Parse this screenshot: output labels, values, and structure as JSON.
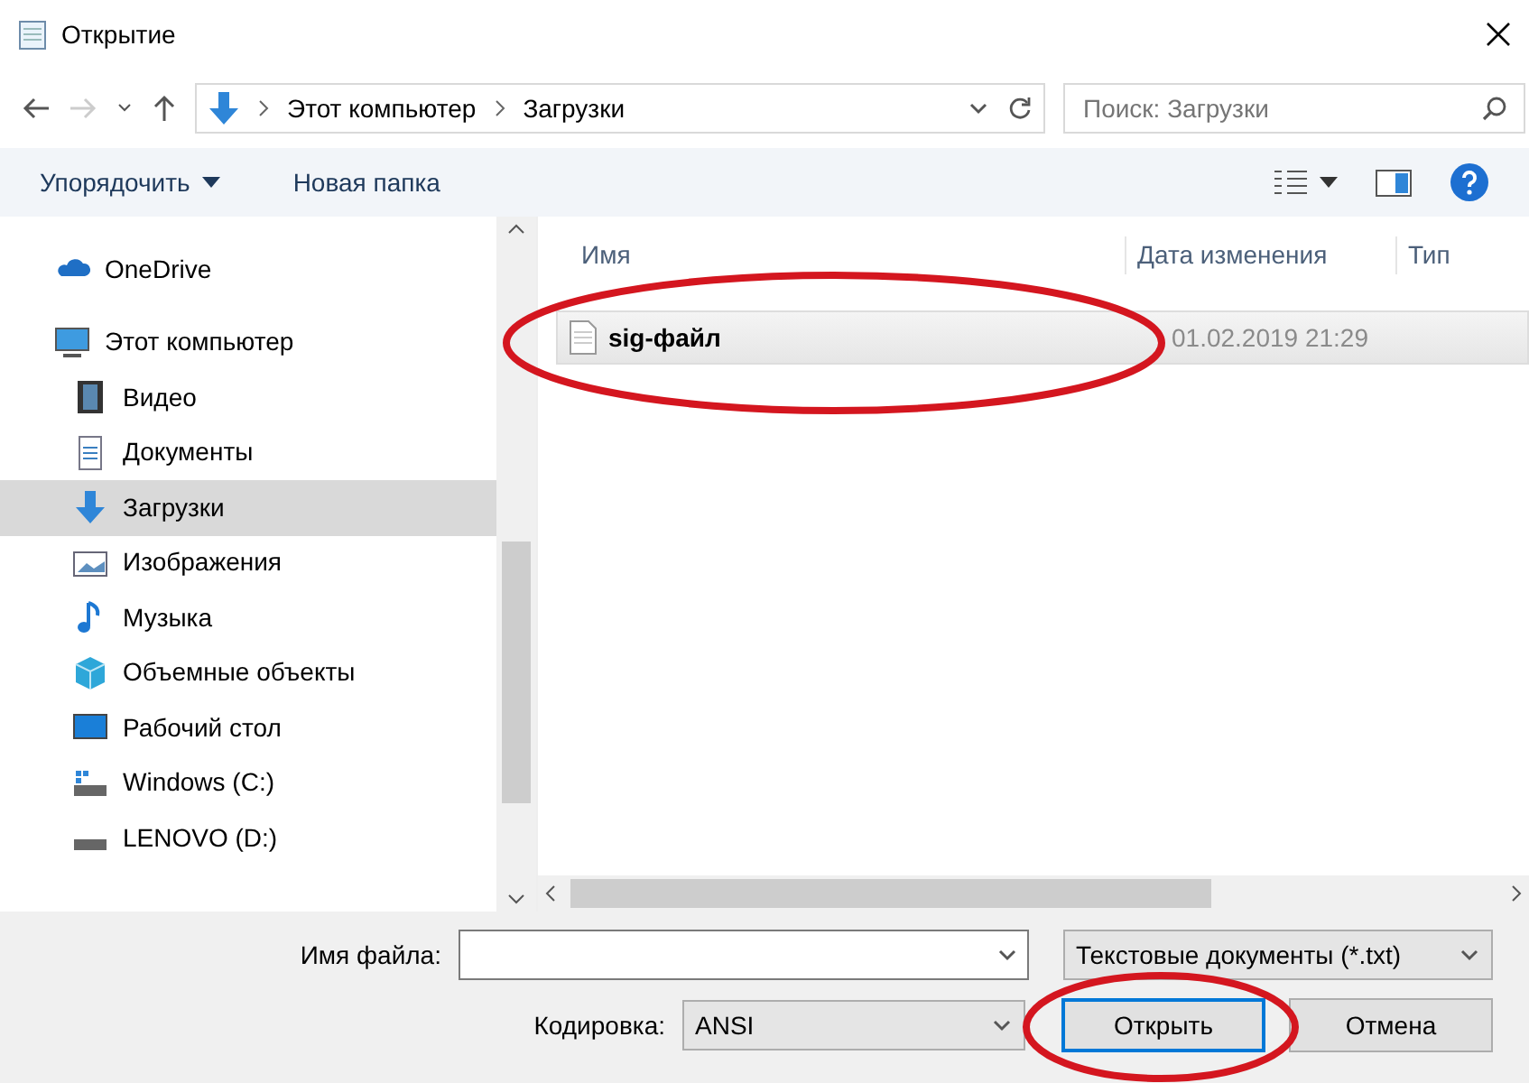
{
  "window": {
    "title": "Открытие"
  },
  "address_bar": {
    "segments": [
      "Этот компьютер",
      "Загрузки"
    ]
  },
  "search": {
    "placeholder": "Поиск: Загрузки"
  },
  "toolbar": {
    "buttons": [
      "Упорядочить",
      "Новая папка"
    ]
  },
  "sidebar": {
    "items": [
      {
        "label": "OneDrive",
        "kind": "cloud",
        "selected": false
      },
      {
        "label": "Этот компьютер",
        "kind": "computer",
        "selected": false,
        "children": [
          {
            "label": "Видео",
            "kind": "video",
            "selected": false
          },
          {
            "label": "Документы",
            "kind": "documents",
            "selected": false
          },
          {
            "label": "Загрузки",
            "kind": "downloads",
            "selected": true
          },
          {
            "label": "Изображения",
            "kind": "pictures",
            "selected": false
          },
          {
            "label": "Музыка",
            "kind": "music",
            "selected": false
          },
          {
            "label": "Объемные объекты",
            "kind": "objects3d",
            "selected": false
          },
          {
            "label": "Рабочий стол",
            "kind": "desktop",
            "selected": false
          },
          {
            "label": "Windows (C:)",
            "kind": "drive_c",
            "selected": false
          },
          {
            "label": "LENOVO (D:)",
            "kind": "drive",
            "selected": false
          }
        ]
      }
    ]
  },
  "file_list": {
    "columns": [
      "Имя",
      "Дата изменения",
      "Тип"
    ],
    "rows": [
      {
        "name": "sig-файл",
        "modified": "01.02.2019 21:29",
        "selected": true
      }
    ]
  },
  "file_name": {
    "label": "Имя файла:"
  },
  "file_type": {
    "value": "Текстовые документы (*.txt)"
  },
  "encoding": {
    "label": "Кодировка:",
    "value": "ANSI"
  },
  "buttons": [
    {
      "label": "Открыть",
      "default": true
    },
    {
      "label": "Отмена",
      "default": false
    }
  ],
  "annotations": [
    {
      "kind": "ellipse"
    },
    {
      "kind": "ellipse"
    }
  ]
}
